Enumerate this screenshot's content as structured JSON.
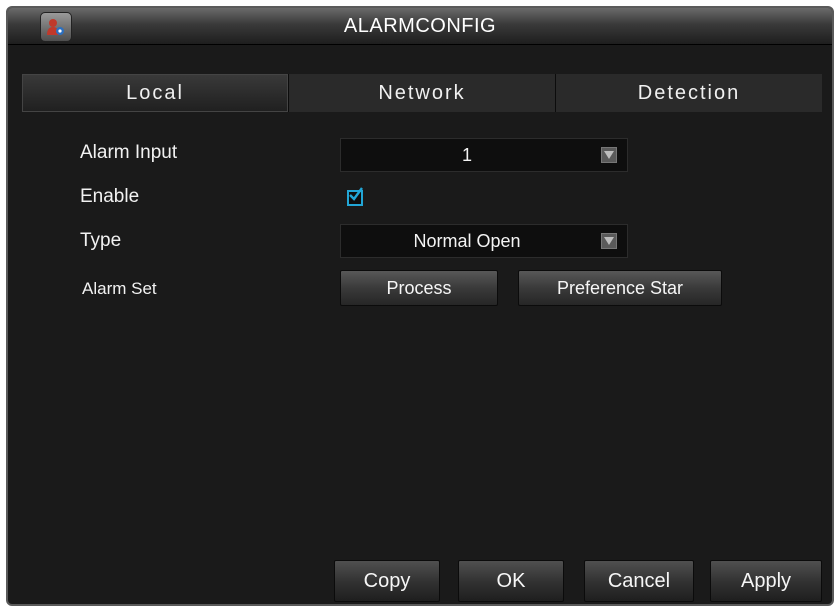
{
  "window": {
    "title": "ALARMCONFIG",
    "icon": "alarm-app-icon"
  },
  "tabs": [
    {
      "label": "Local",
      "active": true
    },
    {
      "label": "Network",
      "active": false
    },
    {
      "label": "Detection",
      "active": false
    }
  ],
  "form": {
    "alarm_input": {
      "label": "Alarm Input",
      "value": "1"
    },
    "enable": {
      "label": "Enable",
      "checked": true
    },
    "type": {
      "label": "Type",
      "value": "Normal Open"
    },
    "alarm_set": {
      "label": "Alarm Set",
      "process_label": "Process",
      "preference_label": "Preference Star"
    }
  },
  "footer": {
    "copy": "Copy",
    "ok": "OK",
    "cancel": "Cancel",
    "apply": "Apply"
  },
  "colors": {
    "background": "#1a1a1a",
    "checkbox_accent": "#22a6d6"
  }
}
